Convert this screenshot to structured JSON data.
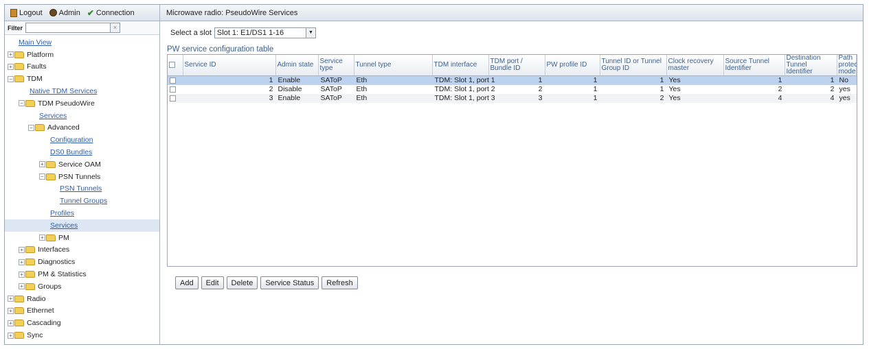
{
  "topbar": {
    "logout": "Logout",
    "admin": "Admin",
    "connection": "Connection"
  },
  "filter": {
    "label": "Filter",
    "value": "",
    "clear": "×"
  },
  "tree": [
    {
      "label": "Main View",
      "type": "link",
      "indent": 0
    },
    {
      "label": "Platform",
      "type": "folder",
      "exp": "+",
      "indent": 0
    },
    {
      "label": "Faults",
      "type": "folder",
      "exp": "+",
      "indent": 0
    },
    {
      "label": "TDM",
      "type": "folder",
      "exp": "−",
      "indent": 0
    },
    {
      "label": "Native TDM Services",
      "type": "link",
      "indent": 1
    },
    {
      "label": "TDM PseudoWire",
      "type": "folder",
      "exp": "−",
      "indent": 1
    },
    {
      "label": "Services",
      "type": "link",
      "indent": 2
    },
    {
      "label": "Advanced",
      "type": "folder",
      "exp": "−",
      "indent": 2
    },
    {
      "label": "Configuration",
      "type": "link",
      "indent": 3
    },
    {
      "label": "DS0 Bundles",
      "type": "link",
      "indent": 3
    },
    {
      "label": "Service OAM",
      "type": "folder",
      "exp": "+",
      "indent": 3
    },
    {
      "label": "PSN Tunnels",
      "type": "folder",
      "exp": "−",
      "indent": 3
    },
    {
      "label": "PSN Tunnels",
      "type": "link",
      "indent": 4
    },
    {
      "label": "Tunnel Groups",
      "type": "link",
      "indent": 4
    },
    {
      "label": "Profiles",
      "type": "link",
      "indent": 3
    },
    {
      "label": "Services",
      "type": "link",
      "indent": 3,
      "selected": true
    },
    {
      "label": "PM",
      "type": "folder",
      "exp": "+",
      "indent": 3
    },
    {
      "label": "Interfaces",
      "type": "folder",
      "exp": "+",
      "indent": 1
    },
    {
      "label": "Diagnostics",
      "type": "folder",
      "exp": "+",
      "indent": 1
    },
    {
      "label": "PM & Statistics",
      "type": "folder",
      "exp": "+",
      "indent": 1
    },
    {
      "label": "Groups",
      "type": "folder",
      "exp": "+",
      "indent": 1
    },
    {
      "label": "Radio",
      "type": "folder",
      "exp": "+",
      "indent": 0
    },
    {
      "label": "Ethernet",
      "type": "folder",
      "exp": "+",
      "indent": 0
    },
    {
      "label": "Cascading",
      "type": "folder",
      "exp": "+",
      "indent": 0
    },
    {
      "label": "Sync",
      "type": "folder",
      "exp": "+",
      "indent": 0
    }
  ],
  "main": {
    "title": "Microwave radio: PseudoWire Services",
    "slot_label": "Select a slot",
    "slot_value": "Slot 1: E1/DS1 1-16",
    "table_caption": "PW service configuration table"
  },
  "table": {
    "columns": [
      "Service ID",
      "Admin state",
      "Service type",
      "Tunnel type",
      "TDM interface",
      "TDM port / Bundle ID",
      "PW profile ID",
      "Tunnel ID or Tunnel Group ID",
      "Clock recovery master",
      "Source Tunnel Identifier",
      "Destination Tunnel Identifier",
      "Path protection mode"
    ],
    "rows": [
      [
        "1",
        "Enable",
        "SAToP",
        "Eth",
        "TDM: Slot 1, port 1",
        "1",
        "1",
        "1",
        "Yes",
        "1",
        "1",
        "No"
      ],
      [
        "2",
        "Disable",
        "SAToP",
        "Eth",
        "TDM: Slot 1, port 2",
        "2",
        "1",
        "1",
        "Yes",
        "2",
        "2",
        "yes"
      ],
      [
        "3",
        "Enable",
        "SAToP",
        "Eth",
        "TDM: Slot 1, port 3",
        "3",
        "1",
        "2",
        "Yes",
        "4",
        "4",
        "yes"
      ]
    ],
    "selected_row": 0
  },
  "buttons": {
    "add": "Add",
    "edit": "Edit",
    "delete": "Delete",
    "service_status": "Service Status",
    "refresh": "Refresh"
  }
}
